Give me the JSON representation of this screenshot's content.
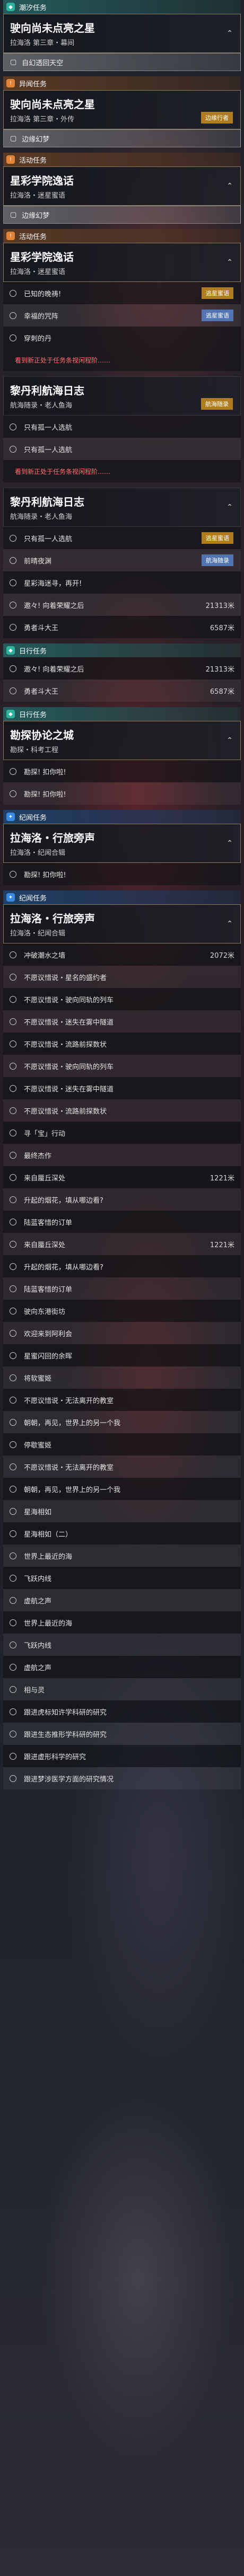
{
  "sections": [
    {
      "title": "潮汐任务",
      "quest": "驶向尚未点亮之星",
      "sub": "拉海洛 第三章・幕间",
      "item": "自幻透回天空"
    },
    {
      "title": "异闻任务",
      "quest": "驶向尚未点亮之星",
      "sub": "拉海洛 第三章・外传",
      "tag": "边缘行者",
      "item": "边缘幻梦"
    },
    {
      "title": "活动任务",
      "quest": "星彩学院逸话",
      "sub": "拉海洛・迷星蜜语",
      "item": "边缘幻梦"
    },
    {
      "title": "活动任务",
      "quest": "星彩学院逸话",
      "sub": "拉海洛・迷星蜜语",
      "items": [
        "已知的晚祷!",
        "幸福的咒阵",
        "穿刺的丹"
      ],
      "tags": [
        "逃星蜜语",
        "逃星蜜语"
      ],
      "note": "看到新正处于任务条视闲程阶……"
    },
    {
      "title": "",
      "quest": "黎丹利航海日志",
      "sub": "航海随录・老人鱼海",
      "items": [
        "只有孤一人选航",
        "只有孤一人选航"
      ],
      "tag": "航海随录",
      "note": "看到新正处于任务条视闲程阶……"
    },
    {
      "title": "",
      "quest": "黎丹利航海日志",
      "sub": "航海随录・老人鱼海",
      "items": [
        "只有孤一人选航",
        "前晴夜渊",
        "星彩海迷寻，再开!",
        "邀々! 向着荣耀之后",
        "勇者斗大王"
      ],
      "values": [
        "21313米",
        "6587米"
      ],
      "tags": [
        "逃星蜜语",
        "航海随录"
      ]
    },
    {
      "title": "日行任务",
      "items": [
        "邀々! 向着荣耀之后",
        "勇者斗大王"
      ],
      "values": [
        "21313米",
        "6587米"
      ]
    },
    {
      "title": "日行任务",
      "quest": "勘探协论之城",
      "sub": "勘探・科考工程",
      "items": [
        "勘探! 扣你啦!",
        "勘探! 扣你啦!"
      ]
    },
    {
      "title": "纪闻任务",
      "quest": "拉海洛・行旅旁声",
      "sub": "拉海洛・纪闻合辑",
      "items": [
        "勘探! 扣你啦!"
      ]
    },
    {
      "title": "纪闻任务",
      "quest": "拉海洛・行旅旁声",
      "sub": "拉海洛・纪闻合辑",
      "items": [
        "冲破潮水之墙",
        "不愿议惜说・星名的盛约者",
        "不愿议惜说・驶向同轨的列车",
        "不愿议惜说・迷失在雾中隧道",
        "不愿议惜说・流路前探数状",
        "不愿议惜说・驶向同轨的列车",
        "不愿议惜说・迷失在雾中隧道",
        "不愿议惜说・流路前探数状",
        "寻「宝」行动",
        "最终杰作",
        "来自蜃丘深处",
        "升起的烟花，填从哪边看?",
        "陆蓝客惜的订单",
        "来自蜃丘深处",
        "升起的烟花，填从哪边看?",
        "陆蓝客惜的订单",
        "驶向东港街坊",
        "欢迎来到阿利会",
        "星蜜闪回的余晖",
        "将软蜜姬",
        "不愿议惜说・无法离开的教室",
        "朝朝，再见，世界上的另一个我",
        "停歇蜜姬",
        "不愿议惜说・无法离开的教室",
        "朝朝，再见，世界上的另一个我",
        "星海相如",
        "星海相如（二）",
        "世界上最近的海",
        "飞跃内线",
        "虚航之声",
        "世界上最近的海",
        "飞跃内线",
        "虚航之声",
        "相与灵",
        "跟进虎标知许学科研的研究",
        "跟进生态推形学科研的研究",
        "跟进虚形科学的研究",
        "跟进梦涉医学方面的研究情况"
      ],
      "values": [
        "2072米",
        "1221米",
        "1221米"
      ]
    }
  ]
}
